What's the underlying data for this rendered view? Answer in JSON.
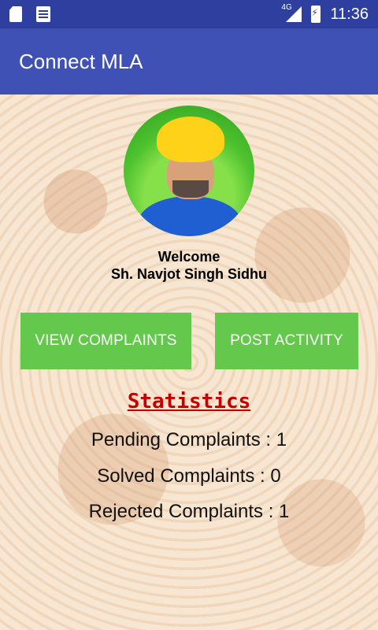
{
  "status_bar": {
    "time": "11:36",
    "network": "4G",
    "icons": [
      "sd-card-icon",
      "document-icon",
      "signal-icon",
      "battery-charging-icon"
    ]
  },
  "app_bar": {
    "title": "Connect MLA"
  },
  "profile": {
    "welcome_label": "Welcome",
    "name": "Sh. Navjot Singh Sidhu"
  },
  "actions": {
    "view_complaints": "VIEW COMPLAINTS",
    "post_activity": "POST ACTIVITY"
  },
  "statistics": {
    "title": "Statistics",
    "pending": "Pending Complaints : 1",
    "solved": "Solved Complaints : 0",
    "rejected": "Rejected Complaints : 1"
  },
  "colors": {
    "status_bar": "#2f3f9f",
    "app_bar": "#3f51b5",
    "button": "#64c84c",
    "stats_title": "#c40000"
  }
}
